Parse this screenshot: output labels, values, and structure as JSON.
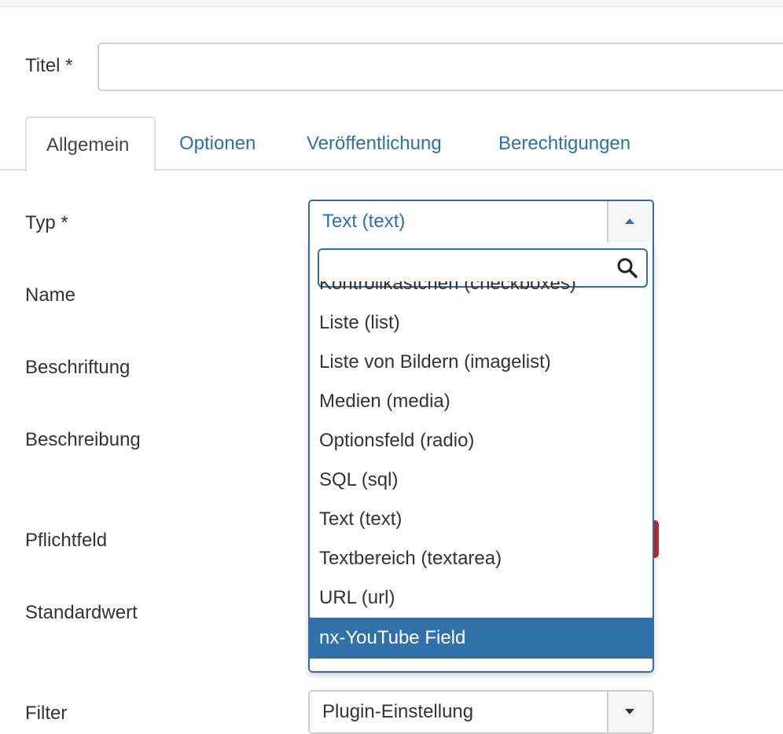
{
  "title_field": {
    "label": "Titel *",
    "value": ""
  },
  "tabs": [
    {
      "label": "Allgemein"
    },
    {
      "label": "Optionen"
    },
    {
      "label": "Veröffentlichung"
    },
    {
      "label": "Berechtigungen"
    }
  ],
  "fields": {
    "typ": "Typ *",
    "name": "Name",
    "beschriftung": "Beschriftung",
    "beschreibung": "Beschreibung",
    "pflichtfeld": "Pflichtfeld",
    "standardwert": "Standardwert",
    "filter": "Filter"
  },
  "typ_select": {
    "value": "Text (text)",
    "search_value": "",
    "options": [
      "Kontrollkästchen (checkboxes)",
      "Liste (list)",
      "Liste von Bildern (imagelist)",
      "Medien (media)",
      "Optionsfeld (radio)",
      "SQL (sql)",
      "Text (text)",
      "Textbereich (textarea)",
      "URL (url)",
      "nx-YouTube Field"
    ],
    "highlighted": "nx-YouTube Field"
  },
  "filter_select": {
    "value": "Plugin-Einstellung"
  },
  "icons": {
    "search": "search-icon",
    "typ_arrow": "caret-up-icon",
    "filter_arrow": "caret-down-icon"
  },
  "colors": {
    "accent": "#2f6fad",
    "highlight": "#3071a9",
    "danger": "#c0272d"
  }
}
